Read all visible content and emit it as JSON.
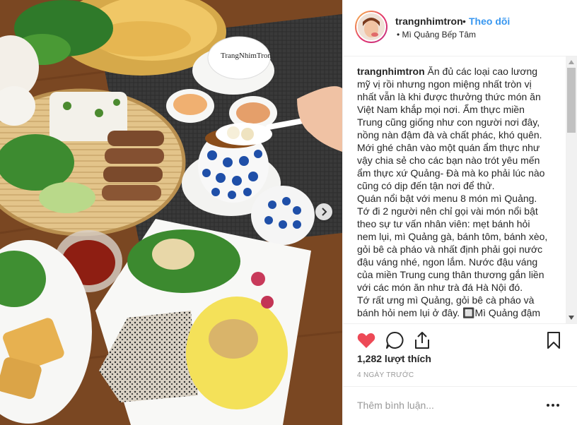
{
  "post": {
    "username": "trangnhimtron",
    "separator": "•",
    "follow_label": "Theo dõi",
    "location": "Mì Quảng Bếp Tâm",
    "location_bullet": "•"
  },
  "logo_text": "TrangNhimTron",
  "caption": {
    "username": "trangnhimtron",
    "paragraphs": [
      "Ăn đủ các loại cao lương mỹ vị rồi nhưng ngon miệng nhất tròn vị nhất vẫn là khi được thưởng thức món ăn Việt Nam khắp mọi nơi. Ẩm thực miền Trung cũng giống như con người nơi đây, nồng nàn đậm đà và chất phác, khó quên. Mới ghé chân vào một quán ẩm thực như vậy chia sẻ cho các bạn nào trót yêu mến ẩm thực xứ Quảng- Đà mà ko phải lúc nào cũng có dịp đến tận nơi để thử.",
      "Quán nổi bật với menu 8 món mì Quảng. Tớ đi 2 người nên chỉ gọi vài món nổi bật theo sự tư vấn nhân viên: mẹt bánh hỏi nem lụi, mì Quảng gà, bánh tôm, bánh xèo, gỏi bê cà pháo và nhất định phải gọi nước đậu váng nhé, ngon lắm. Nước đậu váng của miền Trung cung thân thương gắn liền với các món ăn như trà đá Hà Nội đó.",
      "Tớ rất ưng mì Quảng, gỏi bê cà pháo và bánh hỏi nem lụi ở đây. 🔲Mì Quảng đậm"
    ]
  },
  "likes": "1,282 lượt thích",
  "time_ago": "4 NGÀY TRƯỚC",
  "comment": {
    "placeholder": "Thêm bình luận..."
  },
  "icons": {
    "like": "heart-icon",
    "comment": "comment-icon",
    "share": "share-icon",
    "save": "bookmark-icon",
    "next": "chevron-right-icon",
    "more": "more-options-icon"
  },
  "colors": {
    "like": "#ed4956",
    "follow": "#3897f0",
    "muted": "#999999",
    "text": "#262626"
  }
}
